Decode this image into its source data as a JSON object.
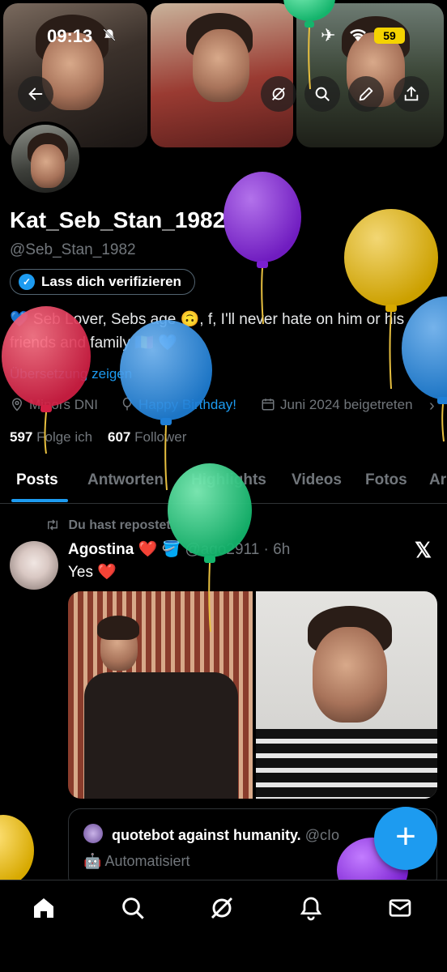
{
  "status_bar": {
    "time": "09:13",
    "battery": "59"
  },
  "profile": {
    "name": "Kat_Seb_Stan_1982",
    "handle": "@Seb_Stan_1982",
    "verify_label": "Lass dich verifizieren",
    "bio": "💙 Seb Lover, Sebs age 🙃, f, I'll never hate on him or his friends and family 🇷🇴 💙",
    "translate_label": "Übersetzung zeigen",
    "location": "Minors DNI",
    "website": "Happy Birthday!",
    "joined": "Juni 2024 beigetreten",
    "following_count": "597",
    "following_label": "Folge ich",
    "followers_count": "607",
    "followers_label": "Follower"
  },
  "tabs": [
    "Posts",
    "Antworten",
    "Highlights",
    "Videos",
    "Fotos",
    "Ar"
  ],
  "active_tab": "Posts",
  "post": {
    "repost_label": "Du hast repostet",
    "author": "Agostina ❤️ 🪣",
    "handle_time": "@ago2911 · 6h",
    "text": "Yes ❤️",
    "quote": {
      "author": "quotebot against humanity.",
      "handle": "@cIo",
      "automated": "Automatisiert"
    }
  },
  "fab_label": "+",
  "icons": {
    "back": "back-arrow-icon",
    "grok": "grok-icon",
    "search": "search-icon",
    "edit": "pencil-icon",
    "share": "share-icon",
    "bell_muted": "bell-slash-icon",
    "airplane": "airplane-icon",
    "wifi": "wifi-icon",
    "repost": "repost-icon",
    "location": "location-pin-icon",
    "link": "balloon-link-icon",
    "calendar": "calendar-icon",
    "x_logo": "x-logo-icon",
    "home": "home-icon",
    "nav_search": "search-icon",
    "nav_grok": "grok-icon",
    "notifications": "bell-icon",
    "messages": "mail-icon"
  },
  "colors": {
    "accent": "#1d9bf0",
    "balloon_purple": "#8a2be2",
    "balloon_yellow": "#e6b800",
    "balloon_red": "#e0304f",
    "balloon_blue": "#2a8be0",
    "balloon_green": "#1fc47a"
  }
}
